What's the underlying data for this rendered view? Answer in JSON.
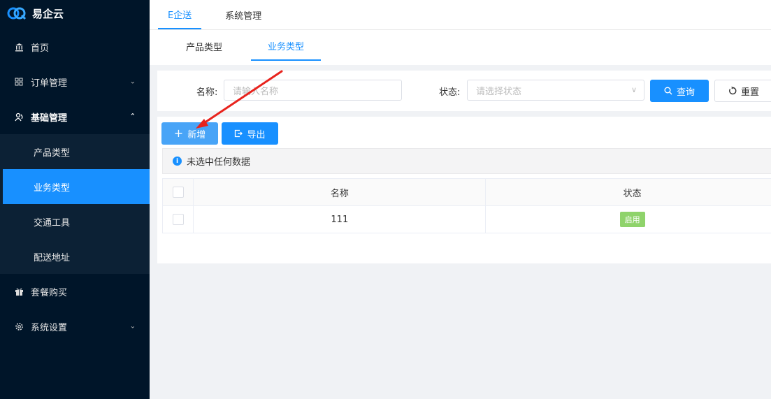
{
  "brand": {
    "name": "易企云"
  },
  "sidebar": {
    "items": [
      {
        "label": "首页",
        "icon": "bank-icon"
      },
      {
        "label": "订单管理",
        "icon": "grid-icon"
      },
      {
        "label": "基础管理",
        "icon": "people-icon"
      },
      {
        "label": "套餐购买",
        "icon": "gift-icon"
      },
      {
        "label": "系统设置",
        "icon": "gear-icon"
      }
    ],
    "submenu": [
      "产品类型",
      "业务类型",
      "交通工具",
      "配送地址"
    ],
    "active_sub": "业务类型"
  },
  "top_tabs": [
    "E企送",
    "系统管理"
  ],
  "sub_tabs": [
    "产品类型",
    "业务类型"
  ],
  "filter": {
    "name_label": "名称:",
    "name_placeholder": "请输入名称",
    "status_label": "状态:",
    "status_placeholder": "请选择状态",
    "search_label": "查询",
    "reset_label": "重置"
  },
  "toolbar": {
    "add_label": "新增",
    "export_label": "导出"
  },
  "alert": {
    "text": "未选中任何数据"
  },
  "table": {
    "columns": [
      "名称",
      "状态"
    ],
    "rows": [
      {
        "name": "111",
        "status": "启用"
      }
    ]
  },
  "colors": {
    "primary": "#1890ff",
    "sidebar": "#001529",
    "enabled_tag": "#8fd36b",
    "annotation": "#e8231d"
  }
}
